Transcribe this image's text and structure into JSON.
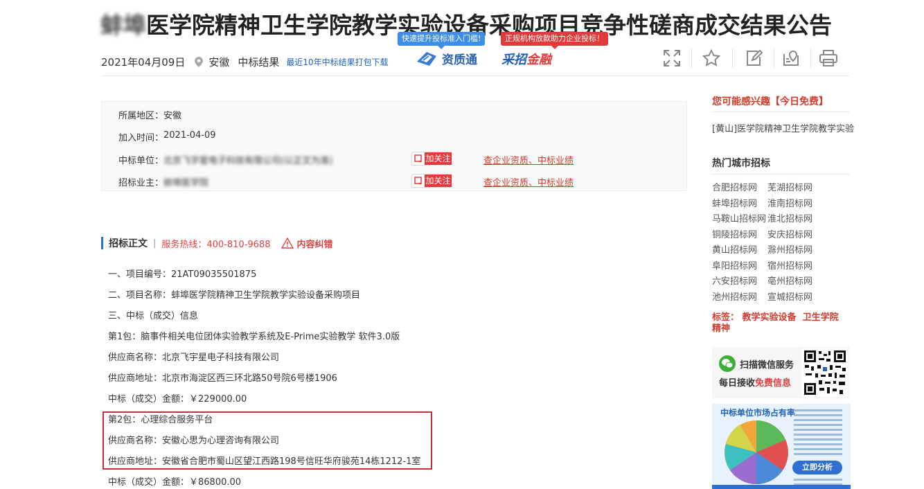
{
  "header": {
    "title_blurred": "蚌埠",
    "title_main": "医学院精神卫生学院教学实验设备采购项目竞争性磋商成交结果公告",
    "date": "2021年04月09日",
    "region": "安徽",
    "type": "中标结果",
    "download_link": "最近10年中标结果打包下载",
    "bubble_left": "快速提升投标准入门槛!",
    "bubble_right": "正规机构放款助力企业投标！",
    "logo_left": "资质通",
    "logo_right_a": "采招",
    "logo_right_b": "金融",
    "tools": [
      "expand-icon",
      "star-icon",
      "edit-icon",
      "location-icon",
      "print-icon"
    ]
  },
  "info": {
    "region_label": "所属地区：",
    "region_value": "安徽",
    "time_label": "加入时间：",
    "time_value": "2021-04-09",
    "winner_label": "中标单位：",
    "winner_value_blurred": "北京飞宇星电子科技有限公司(以正文为准)",
    "owner_label": "招标业主：",
    "owner_value_blurred": "蚌埠医学院",
    "follow_label": "加关注",
    "query_link": "查企业资质、中标业绩"
  },
  "section": {
    "title": "招标正文",
    "separator": "|",
    "hotline": "服务热线：400-810-9688",
    "report": "内容纠错"
  },
  "body_lines": [
    "一、项目编号：21AT09035501875",
    "二、项目名称：蚌埠医学院精神卫生学院教学实验设备采购项目",
    "三、中标（成交）信息",
    "第1包：脑事件相关电位团体实验教学系统及E-Prime实验教学 软件3.0版",
    "供应商名称：北京飞宇星电子科技有限公司",
    "供应商地址：北京市海淀区西三环北路50号院6号楼1906",
    "中标（成交）金额：￥229000.00",
    "第2包：心理综合服务平台",
    "供应商名称：安徽心思为心理咨询有限公司",
    "供应商地址：安徽省合肥市蜀山区望江西路198号信旺华府骏苑14栋1212-1室",
    "中标（成交）金额：￥86800.00"
  ],
  "sidebar": {
    "interest_title": "您可能感兴趣【今日免费】",
    "interest_link": "[黄山]医学院精神卫生学院教学实验",
    "hot_title": "热门城市招标",
    "cities": [
      "合肥招标网",
      "芜湖招标网",
      "蚌埠招标网",
      "淮南招标网",
      "马鞍山招标网",
      "淮北招标网",
      "铜陵招标网",
      "安庆招标网",
      "黄山招标网",
      "滁州招标网",
      "阜阳招标网",
      "宿州招标网",
      "六安招标网",
      "亳州招标网",
      "池州招标网",
      "宣城招标网"
    ],
    "tags_label": "标签：",
    "tags": [
      "教学实验设备",
      "卫生学院",
      "精神"
    ],
    "wechat_line1": "扫描微信服务",
    "wechat_line2_a": "每日接收",
    "wechat_line2_b": "免费信息",
    "ad_title": "中标单位市场占有率",
    "ad_button": "立即分析"
  },
  "colors": {
    "accent_red": "#d33b2c",
    "link_blue": "#1d63b8",
    "highlight_box": "#c0303a"
  }
}
